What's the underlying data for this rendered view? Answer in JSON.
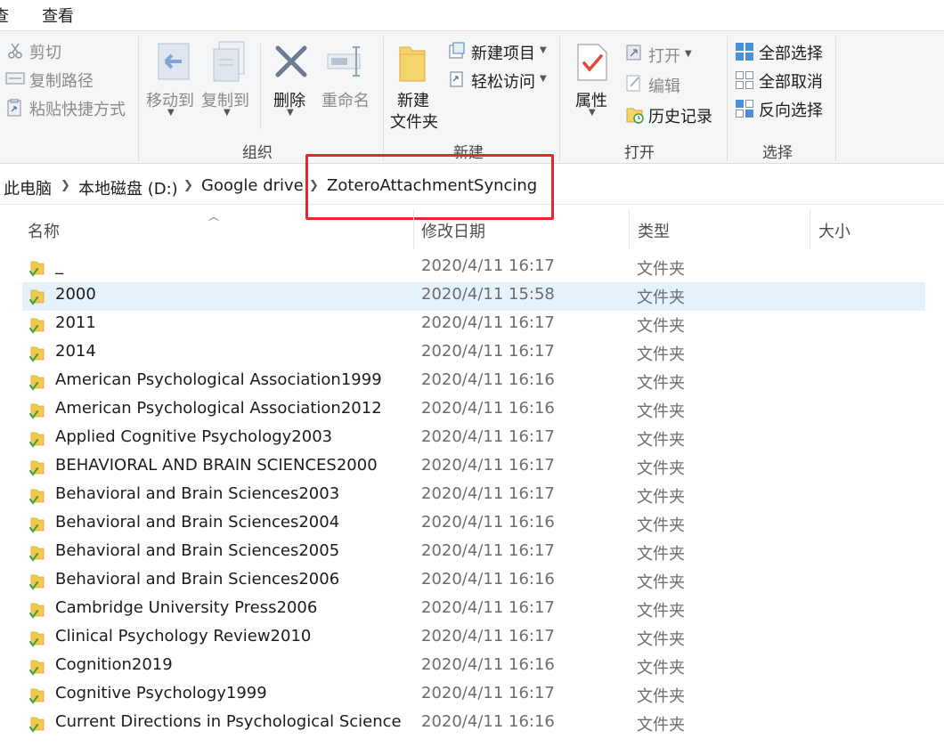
{
  "tabs": {
    "partial": "查",
    "view": "查看"
  },
  "ribbon": {
    "clipboard": {
      "cut": "剪切",
      "copy_path": "复制路径",
      "paste_shortcut": "粘贴快捷方式"
    },
    "organize": {
      "label": "组织",
      "move_to": "移动到",
      "copy_to": "复制到",
      "delete": "删除",
      "rename": "重命名"
    },
    "new": {
      "label": "新建",
      "new_folder_l1": "新建",
      "new_folder_l2": "文件夹",
      "new_item": "新建项目",
      "easy_access": "轻松访问"
    },
    "open": {
      "label": "打开",
      "properties": "属性",
      "open": "打开",
      "edit": "编辑",
      "history": "历史记录"
    },
    "select": {
      "label": "选择",
      "select_all": "全部选择",
      "select_none": "全部取消",
      "invert": "反向选择"
    }
  },
  "breadcrumb": [
    "此电脑",
    "本地磁盘 (D:)",
    "Google drive",
    "ZoteroAttachmentSyncing"
  ],
  "columns": {
    "name": "名称",
    "date": "修改日期",
    "type": "类型",
    "size": "大小"
  },
  "files": [
    {
      "name": "_",
      "date": "2020/4/11 16:17",
      "type": "文件夹"
    },
    {
      "name": "2000",
      "date": "2020/4/11 15:58",
      "type": "文件夹"
    },
    {
      "name": "2011",
      "date": "2020/4/11 16:17",
      "type": "文件夹"
    },
    {
      "name": "2014",
      "date": "2020/4/11 16:17",
      "type": "文件夹"
    },
    {
      "name": "American Psychological Association1999",
      "date": "2020/4/11 16:16",
      "type": "文件夹"
    },
    {
      "name": "American Psychological Association2012",
      "date": "2020/4/11 16:16",
      "type": "文件夹"
    },
    {
      "name": "Applied Cognitive Psychology2003",
      "date": "2020/4/11 16:17",
      "type": "文件夹"
    },
    {
      "name": "BEHAVIORAL AND BRAIN SCIENCES2000",
      "date": "2020/4/11 16:17",
      "type": "文件夹"
    },
    {
      "name": "Behavioral and Brain Sciences2003",
      "date": "2020/4/11 16:17",
      "type": "文件夹"
    },
    {
      "name": "Behavioral and Brain Sciences2004",
      "date": "2020/4/11 16:16",
      "type": "文件夹"
    },
    {
      "name": "Behavioral and Brain Sciences2005",
      "date": "2020/4/11 16:17",
      "type": "文件夹"
    },
    {
      "name": "Behavioral and Brain Sciences2006",
      "date": "2020/4/11 16:16",
      "type": "文件夹"
    },
    {
      "name": "Cambridge University Press2006",
      "date": "2020/4/11 16:17",
      "type": "文件夹"
    },
    {
      "name": "Clinical Psychology Review2010",
      "date": "2020/4/11 16:17",
      "type": "文件夹"
    },
    {
      "name": "Cognition2019",
      "date": "2020/4/11 16:16",
      "type": "文件夹"
    },
    {
      "name": "Cognitive Psychology1999",
      "date": "2020/4/11 16:17",
      "type": "文件夹"
    },
    {
      "name": "Current Directions in Psychological Science...",
      "date": "2020/4/11 16:16",
      "type": "文件夹"
    }
  ],
  "selected_index": 1,
  "colors": {
    "selection": "#e5f1fb",
    "highlight_box": "#e8262b",
    "folder": "#f2c94c",
    "sync_check": "#3aa23a"
  }
}
